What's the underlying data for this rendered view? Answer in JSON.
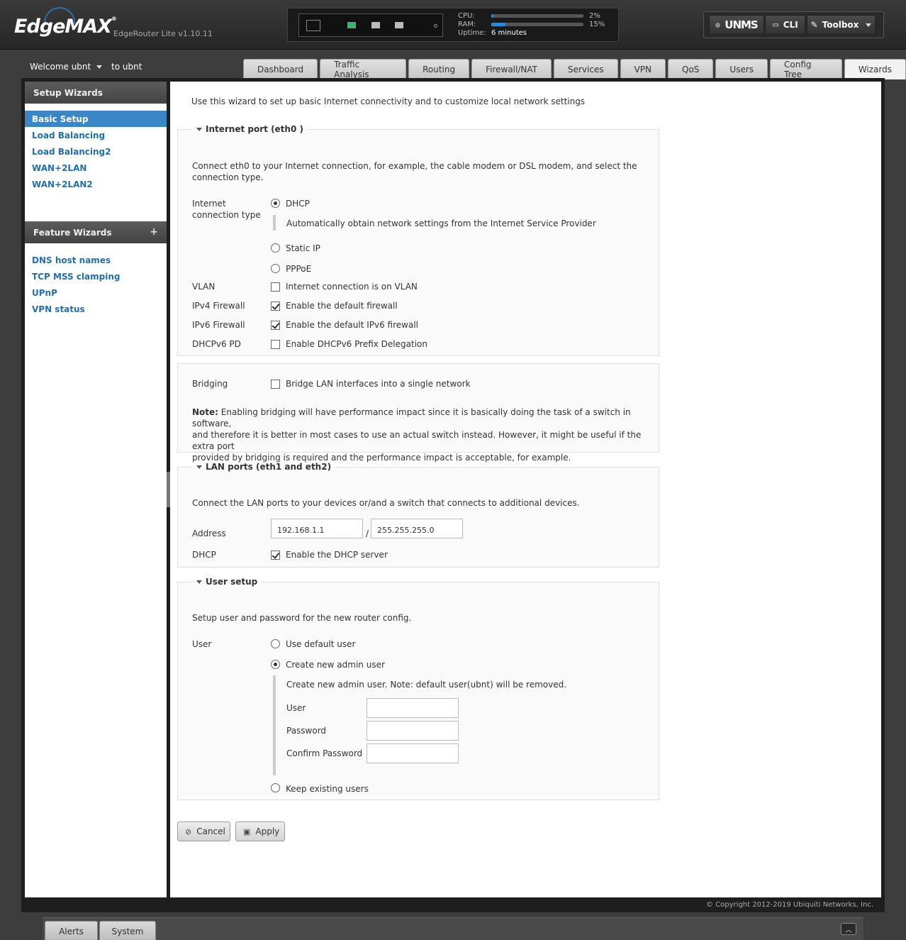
{
  "header": {
    "logo": "EdgeMAX",
    "model": "EdgeRouter Lite v1.10.11",
    "cpu_label": "CPU:",
    "cpu_pct": "2%",
    "cpu_value": 2,
    "ram_label": "RAM:",
    "ram_pct": "15%",
    "ram_value": 15,
    "uptime_label": "Uptime:",
    "uptime_value": "6 minutes",
    "unms": "UNMS",
    "cli": "CLI",
    "toolbox": "Toolbox"
  },
  "nav": {
    "welcome": "Welcome ubnt",
    "to_user": "to ubnt",
    "tabs": [
      "Dashboard",
      "Traffic Analysis",
      "Routing",
      "Firewall/NAT",
      "Services",
      "VPN",
      "QoS",
      "Users",
      "Config Tree",
      "Wizards"
    ],
    "active_tab": "Wizards"
  },
  "sidebar": {
    "setup_title": "Setup Wizards",
    "setup_items": [
      "Basic Setup",
      "Load Balancing",
      "Load Balancing2",
      "WAN+2LAN",
      "WAN+2LAN2"
    ],
    "feature_title": "Feature Wizards",
    "feature_plus": "+",
    "feature_items": [
      "DNS host names",
      "TCP MSS clamping",
      "UPnP",
      "VPN status"
    ]
  },
  "wizard": {
    "intro": "Use this wizard to set up basic Internet connectivity and to customize local network settings",
    "internet": {
      "legend": "Internet port (eth0 )",
      "desc_line1": "Connect eth0 to your Internet connection, for example, the cable modem or DSL modem, and select the",
      "desc_line2": "connection type.",
      "conn_label_1": "Internet",
      "conn_label_2": "connection type",
      "opt_dhcp": "DHCP",
      "dhcp_note": "Automatically obtain network settings from the Internet Service Provider",
      "opt_static": "Static IP",
      "opt_pppoe": "PPPoE",
      "vlan_label": "VLAN",
      "vlan_text": "Internet connection is on VLAN",
      "ipv4_label": "IPv4 Firewall",
      "ipv4_text": "Enable the default firewall",
      "ipv6_label": "IPv6 Firewall",
      "ipv6_text": "Enable the default IPv6 firewall",
      "pd_label": "DHCPv6 PD",
      "pd_text": "Enable DHCPv6 Prefix Delegation"
    },
    "bridging": {
      "label": "Bridging",
      "text": "Bridge LAN interfaces into a single network",
      "note_bold": "Note:",
      "note_line1": " Enabling bridging will have performance impact since it is basically doing the task of a switch in software,",
      "note_line2": "and therefore it is better in most cases to use an actual switch instead. However, it might be useful if the extra port",
      "note_line3": "provided by bridging is required and the performance impact is acceptable, for example."
    },
    "lan": {
      "legend": "LAN ports (eth1 and eth2)",
      "desc": "Connect the LAN ports to your devices or/and a switch that connects to additional devices.",
      "address_label": "Address",
      "address": "192.168.1.1",
      "slash": "/",
      "netmask": "255.255.255.0",
      "dhcp_label": "DHCP",
      "dhcp_text": "Enable the DHCP server"
    },
    "user": {
      "legend": "User setup",
      "desc": "Setup user and password for the new router config.",
      "label": "User",
      "opt_default": "Use default user",
      "opt_new": "Create new admin user",
      "new_note": "Create new admin user. Note: default user(ubnt) will be removed.",
      "user_label": "User",
      "password_label": "Password",
      "confirm_label": "Confirm Password",
      "opt_keep": "Keep existing users"
    },
    "cancel": "Cancel",
    "apply": "Apply"
  },
  "footer": {
    "copyright": "© Copyright 2012-2019 Ubiquiti Networks, Inc.",
    "alerts": "Alerts",
    "system": "System"
  }
}
